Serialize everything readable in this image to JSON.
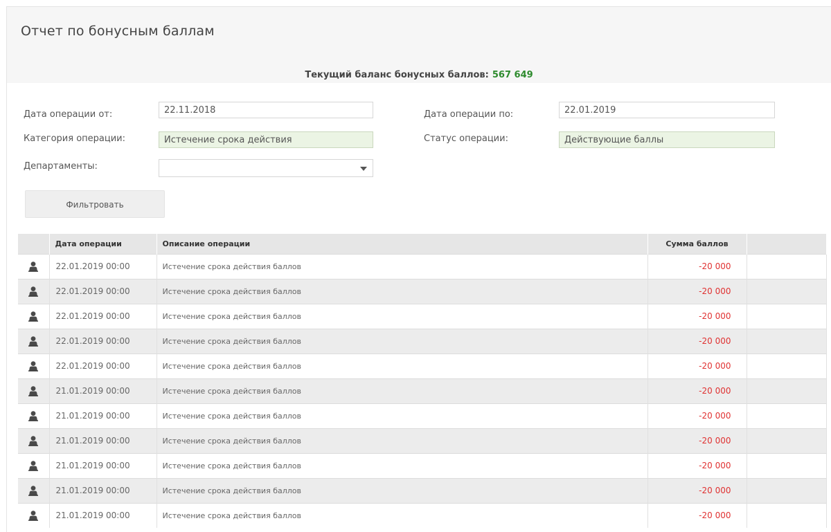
{
  "title": "Отчет по бонусным баллам",
  "balance": {
    "label": "Текущий баланс бонусных баллов:",
    "value": "567 649",
    "value_color": "#2e8b2e"
  },
  "filters": {
    "date_from": {
      "label": "Дата операции от:",
      "value": "22.11.2018"
    },
    "date_to": {
      "label": "Дата операции по:",
      "value": "22.01.2019"
    },
    "category": {
      "label": "Категория операции:",
      "value": "Истечение срока действия"
    },
    "status": {
      "label": "Статус операции:",
      "value": "Действующие баллы"
    },
    "departments": {
      "label": "Департаменты:",
      "value": ""
    },
    "filter_button": "Фильтровать"
  },
  "table": {
    "columns": [
      "",
      "Дата операции",
      "Описание операции",
      "Сумма баллов",
      ""
    ],
    "rows": [
      {
        "icon": "user-icon",
        "date": "22.01.2019 00:00",
        "description": "Истечение срока действия баллов",
        "amount": "-20 000"
      },
      {
        "icon": "user-icon",
        "date": "22.01.2019 00:00",
        "description": "Истечение срока действия баллов",
        "amount": "-20 000"
      },
      {
        "icon": "user-icon",
        "date": "22.01.2019 00:00",
        "description": "Истечение срока действия баллов",
        "amount": "-20 000"
      },
      {
        "icon": "user-icon",
        "date": "22.01.2019 00:00",
        "description": "Истечение срока действия баллов",
        "amount": "-20 000"
      },
      {
        "icon": "user-icon",
        "date": "22.01.2019 00:00",
        "description": "Истечение срока действия баллов",
        "amount": "-20 000"
      },
      {
        "icon": "user-icon",
        "date": "21.01.2019 00:00",
        "description": "Истечение срока действия баллов",
        "amount": "-20 000"
      },
      {
        "icon": "user-icon",
        "date": "21.01.2019 00:00",
        "description": "Истечение срока действия баллов",
        "amount": "-20 000"
      },
      {
        "icon": "user-icon",
        "date": "21.01.2019 00:00",
        "description": "Истечение срока действия баллов",
        "amount": "-20 000"
      },
      {
        "icon": "user-icon",
        "date": "21.01.2019 00:00",
        "description": "Истечение срока действия баллов",
        "amount": "-20 000"
      },
      {
        "icon": "user-icon",
        "date": "21.01.2019 00:00",
        "description": "Истечение срока действия баллов",
        "amount": "-20 000"
      },
      {
        "icon": "user-icon",
        "date": "21.01.2019 00:00",
        "description": "Истечение срока действия баллов",
        "amount": "-20 000"
      }
    ],
    "amount_color": "#e03131"
  }
}
